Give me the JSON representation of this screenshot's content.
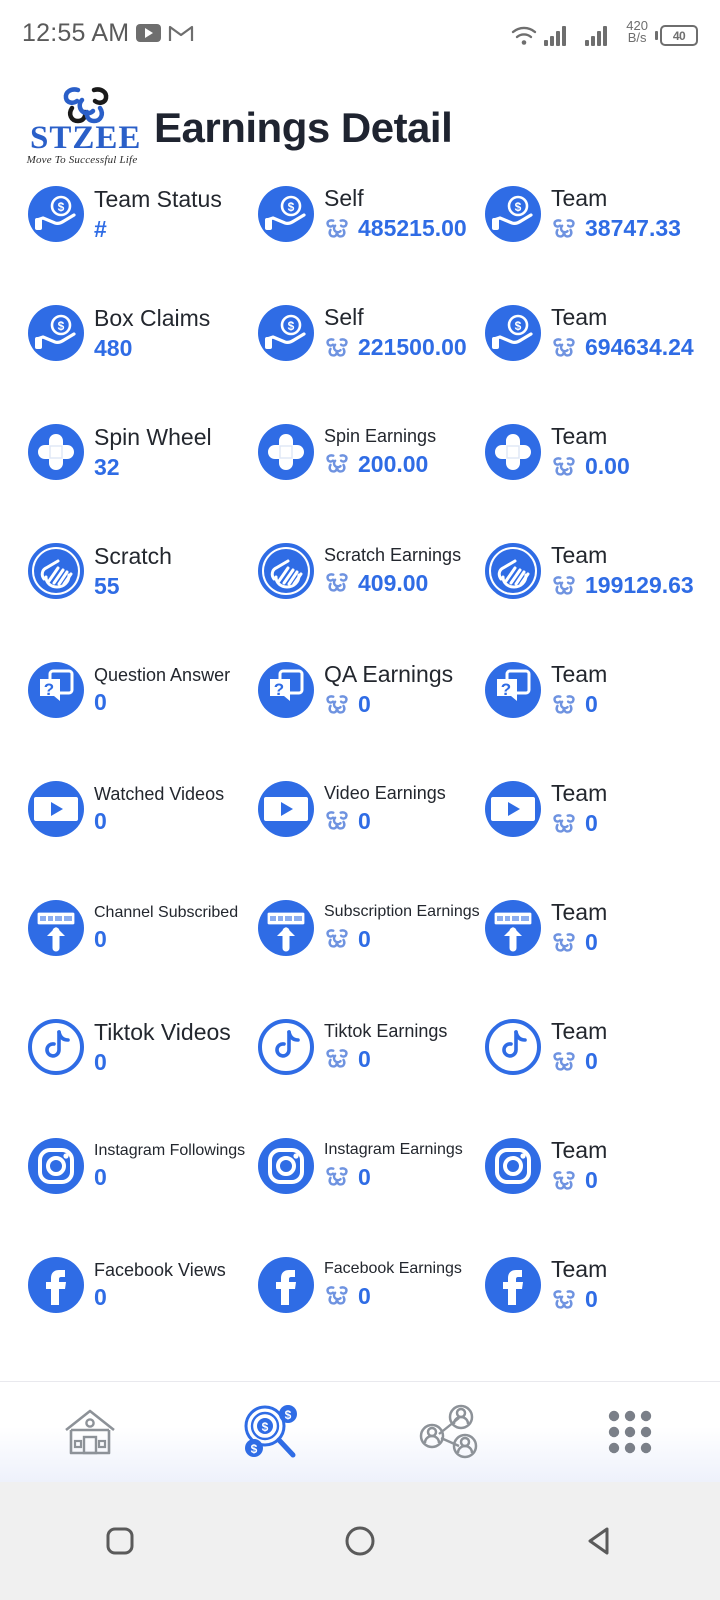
{
  "statusbar": {
    "time": "12:55 AM",
    "youtube_icon": "youtube-icon",
    "gmail_icon": "gmail-icon",
    "wifi_icon": "wifi-icon",
    "signal_icon": "signal-bars-icon",
    "network_speed": "420",
    "network_speed_unit": "B/s",
    "battery_level": "40"
  },
  "header": {
    "logo_word": "STZEE",
    "logo_tagline": "Move To Successful Life",
    "title": "Earnings Detail"
  },
  "colors": {
    "accent": "#2f6ce5",
    "icon_blue": "#2f6ce5",
    "text_dark": "#23272e",
    "nav_gray": "#6e7278"
  },
  "rows": [
    {
      "icon": "hand-coin-icon",
      "self_count": {
        "label": "Team Status",
        "value": "#",
        "label_size": "lg"
      },
      "self_earn": {
        "label": "Self",
        "value": "485215.00",
        "label_size": "lg"
      },
      "team_earn": {
        "label": "Team",
        "value": "38747.33",
        "label_size": "lg"
      }
    },
    {
      "icon": "hand-coin-icon",
      "self_count": {
        "label": "Box Claims",
        "value": "480",
        "label_size": "lg"
      },
      "self_earn": {
        "label": "Self",
        "value": "221500.00",
        "label_size": "lg"
      },
      "team_earn": {
        "label": "Team",
        "value": "694634.24",
        "label_size": "lg"
      }
    },
    {
      "icon": "spin-wheel-icon",
      "self_count": {
        "label": "Spin Wheel",
        "value": "32",
        "label_size": "lg"
      },
      "self_earn": {
        "label": "Spin Earnings",
        "value": "200.00",
        "label_size": "sm"
      },
      "team_earn": {
        "label": "Team",
        "value": "0.00",
        "label_size": "lg"
      }
    },
    {
      "icon": "scratch-hand-icon",
      "self_count": {
        "label": "Scratch",
        "value": "55",
        "label_size": "lg"
      },
      "self_earn": {
        "label": "Scratch Earnings",
        "value": "409.00",
        "label_size": "sm"
      },
      "team_earn": {
        "label": "Team",
        "value": "199129.63",
        "label_size": "lg"
      }
    },
    {
      "icon": "question-answer-icon",
      "self_count": {
        "label": "Question Answer",
        "value": "0",
        "label_size": "sm"
      },
      "self_earn": {
        "label": "QA Earnings",
        "value": "0",
        "label_size": "lg"
      },
      "team_earn": {
        "label": "Team",
        "value": "0",
        "label_size": "lg"
      }
    },
    {
      "icon": "video-film-icon",
      "self_count": {
        "label": "Watched Videos",
        "value": "0",
        "label_size": "sm"
      },
      "self_earn": {
        "label": "Video Earnings",
        "value": "0",
        "label_size": "sm"
      },
      "team_earn": {
        "label": "Team",
        "value": "0",
        "label_size": "lg"
      }
    },
    {
      "icon": "subscribe-arrow-icon",
      "self_count": {
        "label": "Channel Subscribed",
        "value": "0",
        "label_size": "xs"
      },
      "self_earn": {
        "label": "Subscription Earnings",
        "value": "0",
        "label_size": "xs"
      },
      "team_earn": {
        "label": "Team",
        "value": "0",
        "label_size": "lg"
      }
    },
    {
      "icon": "tiktok-icon",
      "self_count": {
        "label": "Tiktok Videos",
        "value": "0",
        "label_size": "lg"
      },
      "self_earn": {
        "label": "Tiktok Earnings",
        "value": "0",
        "label_size": "sm"
      },
      "team_earn": {
        "label": "Team",
        "value": "0",
        "label_size": "lg"
      }
    },
    {
      "icon": "instagram-icon",
      "self_count": {
        "label": "Instagram Followings",
        "value": "0",
        "label_size": "xs"
      },
      "self_earn": {
        "label": "Instagram Earnings",
        "value": "0",
        "label_size": "xs"
      },
      "team_earn": {
        "label": "Team",
        "value": "0",
        "label_size": "lg"
      }
    },
    {
      "icon": "facebook-icon",
      "self_count": {
        "label": "Facebook Views",
        "value": "0",
        "label_size": "sm"
      },
      "self_earn": {
        "label": "Facebook Earnings",
        "value": "0",
        "label_size": "xs"
      },
      "team_earn": {
        "label": "Team",
        "value": "0",
        "label_size": "lg"
      }
    }
  ],
  "bottom_nav": {
    "items": [
      {
        "name": "home-icon",
        "active": false
      },
      {
        "name": "earnings-search-icon",
        "active": true
      },
      {
        "name": "team-network-icon",
        "active": false
      },
      {
        "name": "grid-menu-icon",
        "active": false
      }
    ]
  },
  "system_nav": {
    "recent": "recent-apps-icon",
    "home": "home-circle-icon",
    "back": "back-triangle-icon"
  }
}
